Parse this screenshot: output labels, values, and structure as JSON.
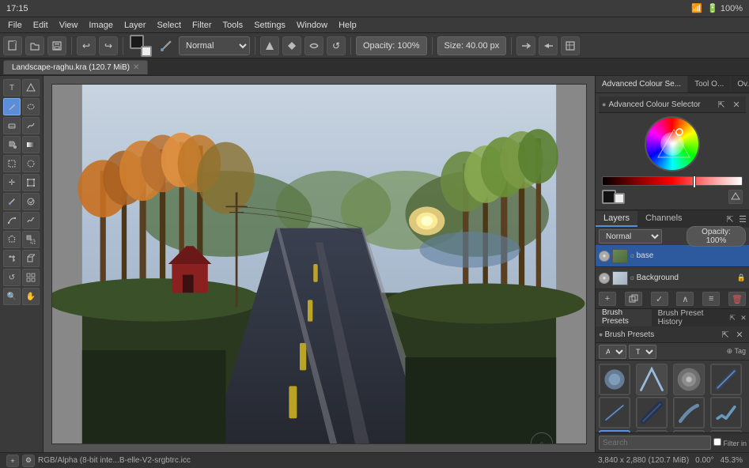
{
  "app": {
    "title": "17:15",
    "window_title": "Landscape-raghu.kra (120.7 MiB)",
    "status_bar_info": "RGB/Alpha (8-bit inte...B-elle-V2-srgbtrc.icc",
    "status_bar_dimensions": "3,840 x 2,880 (120.7 MiB)",
    "status_bar_rotation": "0.00°",
    "status_bar_zoom": "45.3%"
  },
  "menu": {
    "items": [
      "File",
      "Edit",
      "View",
      "Image",
      "Layer",
      "Select",
      "Filter",
      "Tools",
      "Settings",
      "Window",
      "Help"
    ]
  },
  "toolbar": {
    "blend_mode": "Normal",
    "opacity_label": "Opacity: 100%",
    "size_label": "Size: 40.00 px",
    "new_label": "New",
    "open_label": "Open",
    "save_label": "Save",
    "undo_label": "Undo",
    "redo_label": "Redo"
  },
  "panel_tabs": {
    "items": [
      "Advanced Colour Se...",
      "Tool O...",
      "Ov..."
    ]
  },
  "colour_selector": {
    "title": "Advanced Colour Selector",
    "panel_title": "Advanced Colour Se"
  },
  "layers_panel": {
    "title": "Layers",
    "tabs": [
      "Layers",
      "Channels"
    ],
    "blend_mode": "Normal",
    "opacity": "Opacity: 100%",
    "layers": [
      {
        "name": "base",
        "visible": true,
        "selected": true,
        "type": "paint"
      },
      {
        "name": "Background",
        "visible": true,
        "selected": false,
        "type": "paint",
        "locked": true
      }
    ],
    "action_buttons": [
      "+",
      "□",
      "✓",
      "∧",
      "≡",
      "🗑"
    ]
  },
  "brush_presets": {
    "title": "Brush Presets",
    "tabs": [
      "Brush Presets",
      "Brush Preset History"
    ],
    "filter_label": "All",
    "tag_label": "Tag",
    "filter_in_tag_label": "Filter in Tag",
    "search_placeholder": "Search",
    "brushes": [
      {
        "id": 1,
        "type": "round-wet",
        "color": "#4466aa"
      },
      {
        "id": 2,
        "type": "round-dry",
        "color": "#7799cc"
      },
      {
        "id": 3,
        "type": "soft-round",
        "color": "#aabbcc"
      },
      {
        "id": 4,
        "type": "liner",
        "color": "#334466"
      },
      {
        "id": 5,
        "type": "flat",
        "color": "#557799"
      },
      {
        "id": 6,
        "type": "dark-round",
        "color": "#223355"
      },
      {
        "id": 7,
        "type": "angled",
        "color": "#335577"
      },
      {
        "id": 8,
        "type": "bristle",
        "color": "#446688"
      },
      {
        "id": 9,
        "type": "blue-round",
        "color": "#5588bb",
        "selected": true
      },
      {
        "id": 10,
        "type": "multi-liner",
        "color": "#334466"
      },
      {
        "id": 11,
        "type": "dry-brush",
        "color": "#667788"
      },
      {
        "id": 12,
        "type": "pen-nib",
        "color": "#4477aa"
      }
    ]
  },
  "canvas_tab": {
    "label": "Landscape-raghu.kra (120.7 MiB)"
  }
}
